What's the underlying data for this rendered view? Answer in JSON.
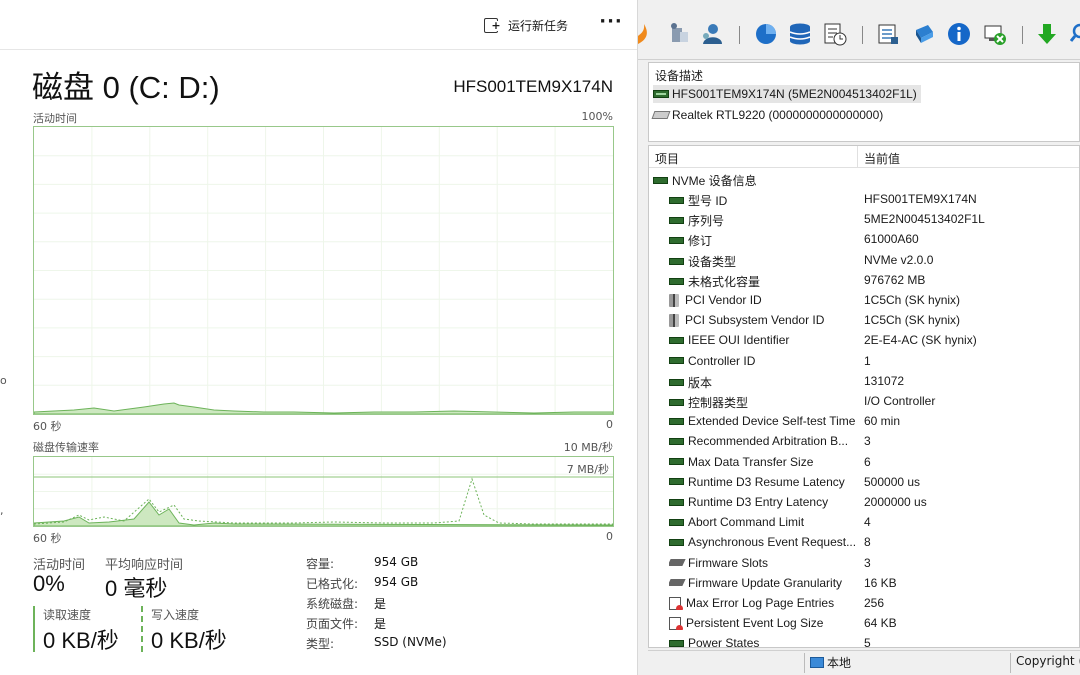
{
  "task_manager": {
    "run_new_task": "运行新任务",
    "more": "···",
    "disk_title": "磁盘 0 (C: D:)",
    "disk_model": "HFS001TEM9X174N",
    "active_time_label": "活动时间",
    "active_time_max": "100%",
    "graph1_left": "60 秒",
    "graph1_right": "0",
    "transfer_label": "磁盘传输速率",
    "transfer_max": "10 MB/秒",
    "transfer_line": "7 MB/秒",
    "graph2_left": "60 秒",
    "graph2_right": "0",
    "stats": {
      "active_time_label": "活动时间",
      "active_time_value": "0%",
      "avg_response_label": "平均响应时间",
      "avg_response_value": "0 毫秒",
      "read_label": "读取速度",
      "read_value": "0 KB/秒",
      "write_label": "写入速度",
      "write_value": "0 KB/秒"
    },
    "props": [
      {
        "k": "容量:",
        "v": "954 GB"
      },
      {
        "k": "已格式化:",
        "v": "954 GB"
      },
      {
        "k": "系统磁盘:",
        "v": "是"
      },
      {
        "k": "页面文件:",
        "v": "是"
      },
      {
        "k": "类型:",
        "v": "SSD (NVMe)"
      }
    ],
    "left_stub_1": "o",
    "left_stub_2": ","
  },
  "aida": {
    "device_header": "设备描述",
    "devices": [
      "HFS001TEM9X174N (5ME2N004513402F1L)",
      "Realtek RTL9220 (0000000000000000)"
    ],
    "col_item": "项目",
    "col_value": "当前值",
    "group": "NVMe 设备信息",
    "rows": [
      {
        "icon": "chip",
        "item": "型号 ID",
        "value": "HFS001TEM9X174N"
      },
      {
        "icon": "chip",
        "item": "序列号",
        "value": "5ME2N004513402F1L"
      },
      {
        "icon": "chip",
        "item": "修订",
        "value": "61000A60"
      },
      {
        "icon": "chip",
        "item": "设备类型",
        "value": "NVMe v2.0.0"
      },
      {
        "icon": "chip",
        "item": "未格式化容量",
        "value": "976762 MB"
      },
      {
        "icon": "pci",
        "item": "PCI Vendor ID",
        "value": "1C5Ch  (SK hynix)"
      },
      {
        "icon": "pci",
        "item": "PCI Subsystem Vendor ID",
        "value": "1C5Ch  (SK hynix)"
      },
      {
        "icon": "chip",
        "item": "IEEE OUI Identifier",
        "value": "2E-E4-AC  (SK hynix)"
      },
      {
        "icon": "chip",
        "item": "Controller ID",
        "value": "1"
      },
      {
        "icon": "chip",
        "item": "版本",
        "value": "131072"
      },
      {
        "icon": "chip",
        "item": "控制器类型",
        "value": "I/O Controller"
      },
      {
        "icon": "chip",
        "item": "Extended Device Self-test Time",
        "value": "60 min"
      },
      {
        "icon": "chip",
        "item": "Recommended Arbitration B...",
        "value": "3"
      },
      {
        "icon": "chip",
        "item": "Max Data Transfer Size",
        "value": "6"
      },
      {
        "icon": "chip",
        "item": "Runtime D3 Resume Latency",
        "value": "500000 us"
      },
      {
        "icon": "chip",
        "item": "Runtime D3 Entry Latency",
        "value": "2000000 us"
      },
      {
        "icon": "chip",
        "item": "Abort Command Limit",
        "value": "4"
      },
      {
        "icon": "chip",
        "item": "Asynchronous Event Request...",
        "value": "8"
      },
      {
        "icon": "fw",
        "item": "Firmware Slots",
        "value": "3"
      },
      {
        "icon": "fw",
        "item": "Firmware Update Granularity",
        "value": "16 KB"
      },
      {
        "icon": "log",
        "item": "Max Error Log Page Entries",
        "value": "256"
      },
      {
        "icon": "log",
        "item": "Persistent Event Log Size",
        "value": "64 KB"
      },
      {
        "icon": "chip",
        "item": "Power States",
        "value": "5"
      }
    ],
    "status_local": "本地",
    "status_copyright": "Copyright ("
  }
}
